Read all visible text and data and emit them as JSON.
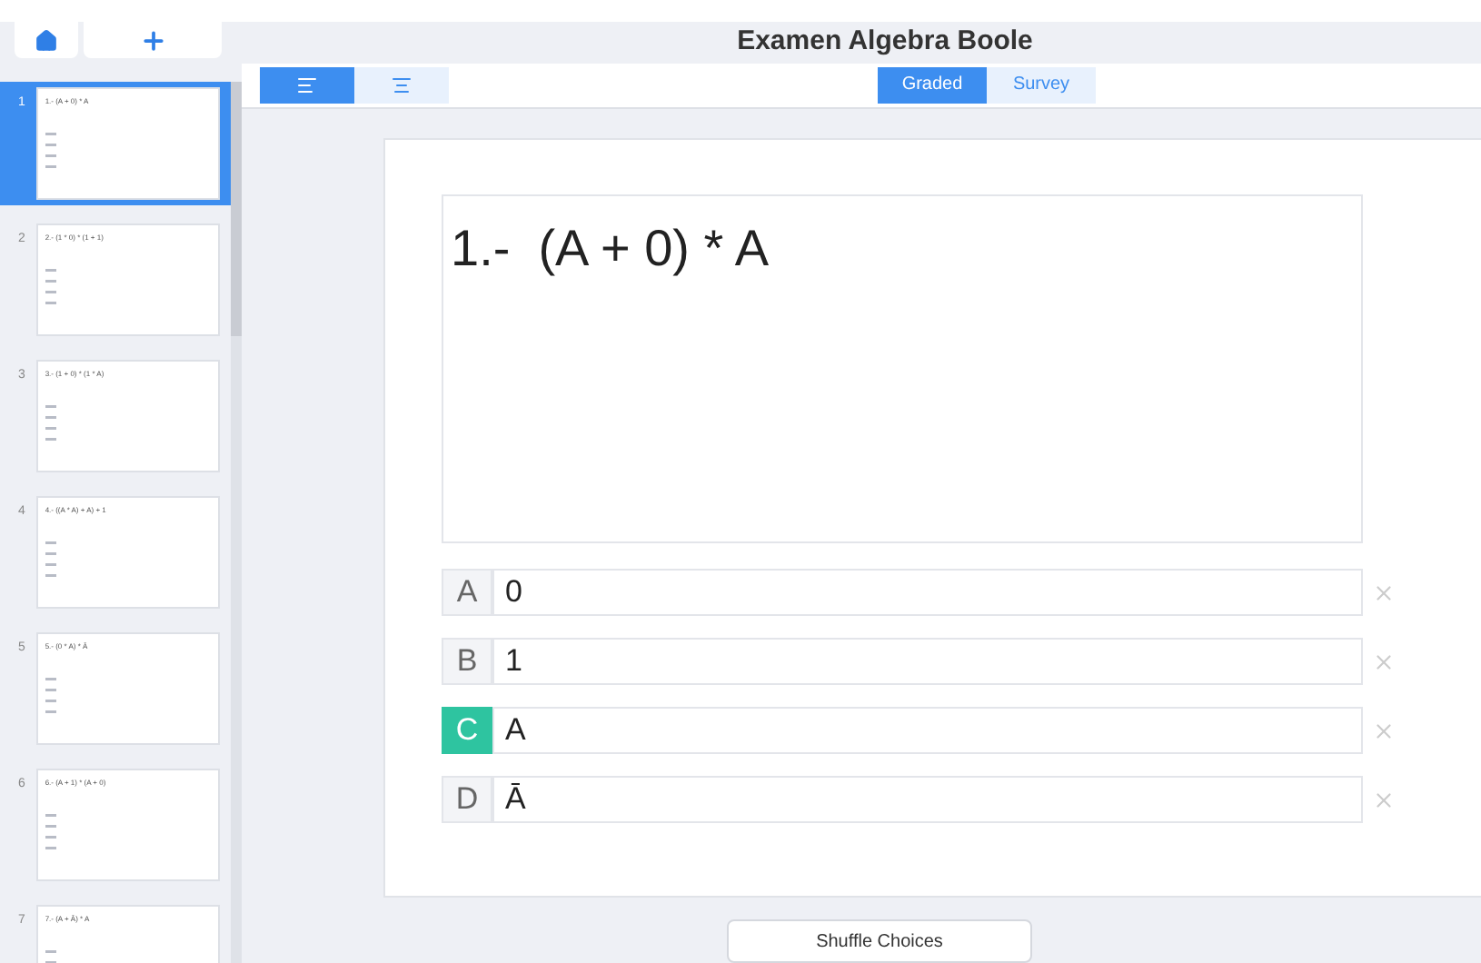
{
  "title": "Examen Algebra Boole",
  "sidebar": {
    "items": [
      {
        "number": "1",
        "question": "1.- (A + 0) * A",
        "selected": true
      },
      {
        "number": "2",
        "question": "2.- (1 * 0) * (1 + 1)",
        "selected": false
      },
      {
        "number": "3",
        "question": "3.- (1 + 0) * (1 * A)",
        "selected": false
      },
      {
        "number": "4",
        "question": "4.- ((A * A) + A) + 1",
        "selected": false
      },
      {
        "number": "5",
        "question": "5.- (0 * A) * Ā",
        "selected": false
      },
      {
        "number": "6",
        "question": "6.- (A + 1) * (A + 0)",
        "selected": false
      },
      {
        "number": "7",
        "question": "7.- (A + Ā) * A",
        "selected": false
      }
    ]
  },
  "view_toggle": [
    {
      "kind": "left",
      "selected": true
    },
    {
      "kind": "center",
      "selected": false
    }
  ],
  "mode_tabs": [
    {
      "label": "Graded",
      "selected": true
    },
    {
      "label": "Survey",
      "selected": false
    }
  ],
  "question": "1.-  (A + 0) * A",
  "choices": [
    {
      "letter": "A",
      "text": "0",
      "correct": false
    },
    {
      "letter": "B",
      "text": "1",
      "correct": false
    },
    {
      "letter": "C",
      "text": "A",
      "correct": true
    },
    {
      "letter": "D",
      "text": "Ā",
      "correct": false
    }
  ],
  "shuffle_button": "Shuffle Choices"
}
